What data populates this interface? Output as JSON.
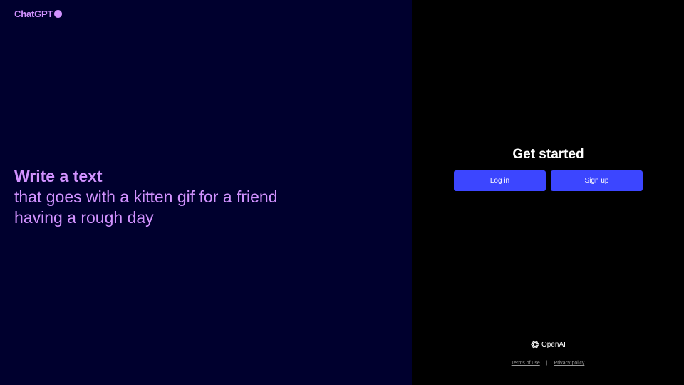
{
  "brand": {
    "name": "ChatGPT",
    "color": "#d292ff"
  },
  "hero": {
    "title": "Write a text",
    "lines": [
      "that goes with a kitten gif for a friend",
      "having a rough day"
    ]
  },
  "auth": {
    "title": "Get started",
    "login_label": "Log in",
    "signup_label": "Sign up",
    "button_color": "#3c46ff"
  },
  "footer": {
    "company": "OpenAI",
    "company_icon": "openai-logo-icon",
    "terms_label": "Terms of use",
    "separator": "|",
    "privacy_label": "Privacy policy"
  },
  "colors": {
    "left_background": "#00002e",
    "right_background": "#000000"
  }
}
